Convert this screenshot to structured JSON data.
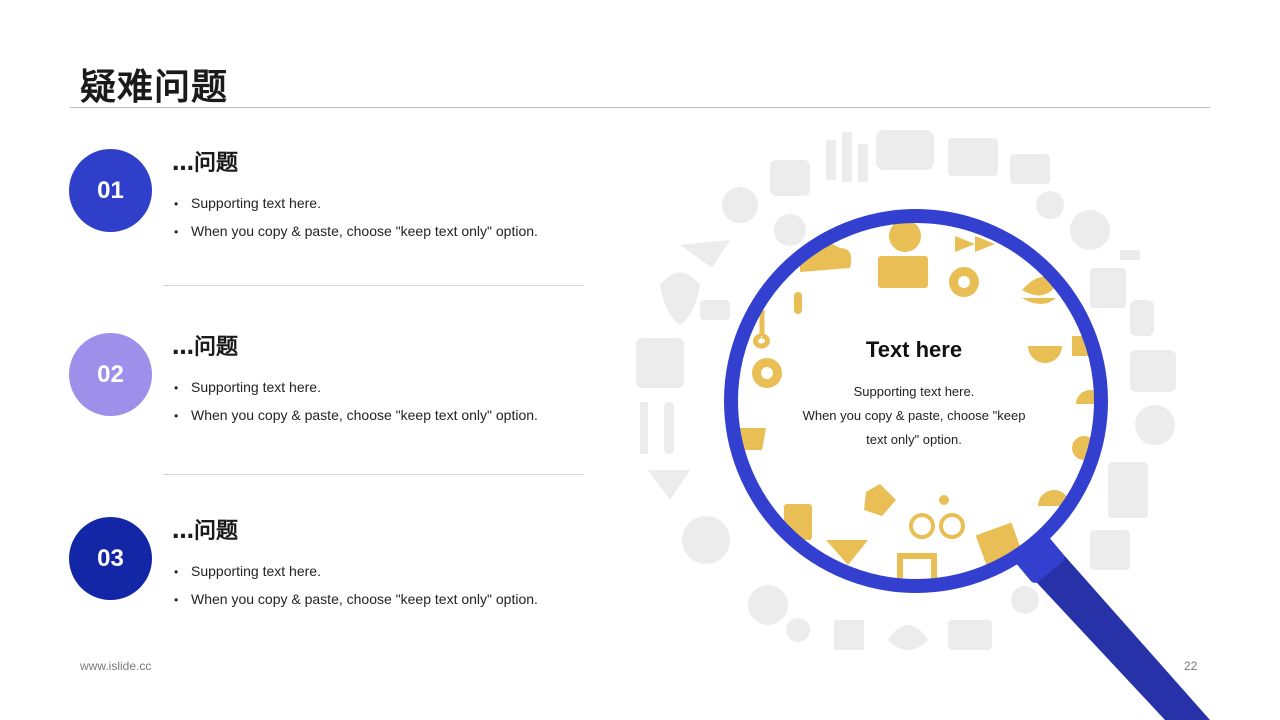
{
  "page": {
    "title": "疑难问题",
    "footer_left": "www.islide.cc",
    "page_number": "22"
  },
  "items": [
    {
      "number": "01",
      "color": "#2f3fc9",
      "heading": "…问题",
      "bullets": [
        "Supporting text here.",
        "When you copy & paste, choose \"keep text only\" option."
      ]
    },
    {
      "number": "02",
      "color": "#9d8fea",
      "heading": "…问题",
      "bullets": [
        "Supporting text here.",
        "When you copy & paste, choose \"keep text only\" option."
      ]
    },
    {
      "number": "03",
      "color": "#1226a6",
      "heading": "…问题",
      "bullets": [
        "Supporting text here.",
        "When you copy & paste, choose \"keep text only\" option."
      ]
    }
  ],
  "lens": {
    "title": "Text here",
    "line1": "Supporting text here.",
    "line2": "When you copy & paste, choose \"keep",
    "line3": "text only\" option."
  },
  "colors": {
    "ring": "#3340cf",
    "handle": "#2731a8",
    "icon_gold": "#e9bf55",
    "icon_grey": "#ececec"
  }
}
